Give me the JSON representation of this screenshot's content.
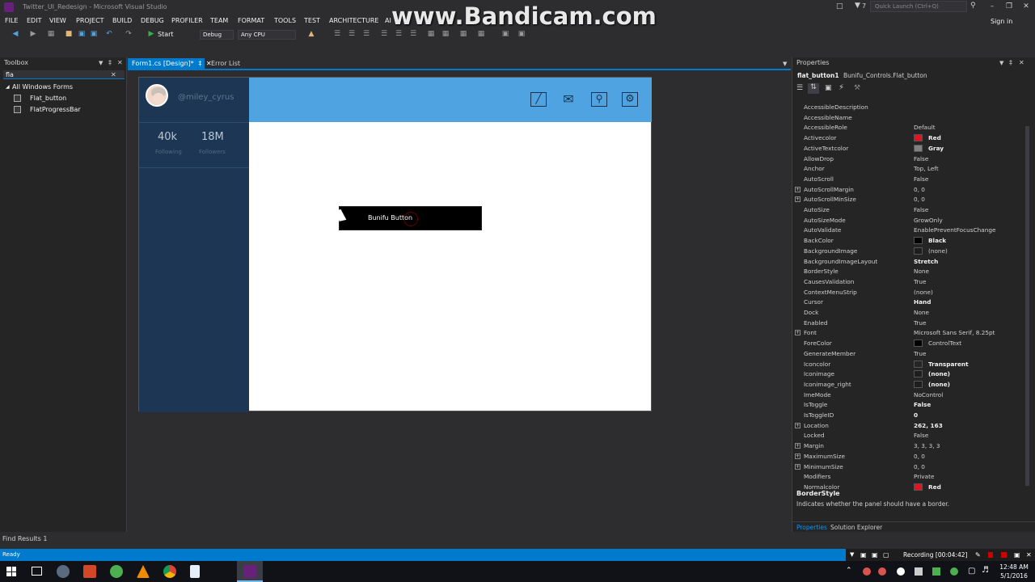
{
  "window": {
    "title": "Twitter_UI_Redesign - Microsoft Visual Studio",
    "notification_count": "7",
    "quick_launch_placeholder": "Quick Launch (Ctrl+Q)",
    "sign_in": "Sign in"
  },
  "watermark": "www.Bandicam.com",
  "menu": [
    "FILE",
    "EDIT",
    "VIEW",
    "PROJECT",
    "BUILD",
    "DEBUG",
    "PROFILER",
    "TEAM",
    "FORMAT",
    "TOOLS",
    "TEST",
    "ARCHITECTURE",
    "AI"
  ],
  "toolbar": {
    "start_label": "Start",
    "config": "Debug",
    "platform": "Any CPU"
  },
  "toolbox": {
    "title": "Toolbox",
    "search_value": "fla",
    "group": "All Windows Forms",
    "items": [
      "Flat_button",
      "FlatProgressBar"
    ]
  },
  "tabs": [
    "Form1.cs [Design]*",
    "Error List"
  ],
  "form": {
    "username": "@miley_cyrus",
    "following_count": "40k",
    "following_label": "Following",
    "followers_count": "18M",
    "followers_label": "Followers",
    "button_text": "Bunifu Button"
  },
  "properties": {
    "title": "Properties",
    "object_name": "flat_button1",
    "object_type": "Bunifu_Controls.Flat_button",
    "rows": [
      {
        "name": "AccessibleDescription",
        "value": ""
      },
      {
        "name": "AccessibleName",
        "value": ""
      },
      {
        "name": "AccessibleRole",
        "value": "Default"
      },
      {
        "name": "Activecolor",
        "value": "Red",
        "swatch": "#e81123",
        "bold": true
      },
      {
        "name": "ActiveTextcolor",
        "value": "Gray",
        "swatch": "#808080",
        "bold": true
      },
      {
        "name": "AllowDrop",
        "value": "False"
      },
      {
        "name": "Anchor",
        "value": "Top, Left"
      },
      {
        "name": "AutoScroll",
        "value": "False"
      },
      {
        "name": "AutoScrollMargin",
        "value": "0, 0",
        "expand": true
      },
      {
        "name": "AutoScrollMinSize",
        "value": "0, 0",
        "expand": true
      },
      {
        "name": "AutoSize",
        "value": "False"
      },
      {
        "name": "AutoSizeMode",
        "value": "GrowOnly"
      },
      {
        "name": "AutoValidate",
        "value": "EnablePreventFocusChange"
      },
      {
        "name": "BackColor",
        "value": "Black",
        "swatch": "#000000",
        "bold": true
      },
      {
        "name": "BackgroundImage",
        "value": "(none)",
        "swatch": "#1e1e1e"
      },
      {
        "name": "BackgroundImageLayout",
        "value": "Stretch",
        "bold": true
      },
      {
        "name": "BorderStyle",
        "value": "None"
      },
      {
        "name": "CausesValidation",
        "value": "True"
      },
      {
        "name": "ContextMenuStrip",
        "value": "(none)"
      },
      {
        "name": "Cursor",
        "value": "Hand",
        "bold": true
      },
      {
        "name": "Dock",
        "value": "None"
      },
      {
        "name": "Enabled",
        "value": "True"
      },
      {
        "name": "Font",
        "value": "Microsoft Sans Serif, 8.25pt",
        "expand": true
      },
      {
        "name": "ForeColor",
        "value": "ControlText",
        "swatch": "#000000"
      },
      {
        "name": "GenerateMember",
        "value": "True"
      },
      {
        "name": "Iconcolor",
        "value": "Transparent",
        "swatch": "#252526",
        "bold": true
      },
      {
        "name": "Iconimage",
        "value": "(none)",
        "swatch": "#1e1e1e",
        "bold": true
      },
      {
        "name": "Iconimage_right",
        "value": "(none)",
        "swatch": "#1e1e1e",
        "bold": true
      },
      {
        "name": "ImeMode",
        "value": "NoControl"
      },
      {
        "name": "IsToggle",
        "value": "False",
        "bold": true
      },
      {
        "name": "IsToggleID",
        "value": "0",
        "bold": true
      },
      {
        "name": "Location",
        "value": "262, 163",
        "expand": true,
        "bold": true
      },
      {
        "name": "Locked",
        "value": "False"
      },
      {
        "name": "Margin",
        "value": "3, 3, 3, 3",
        "expand": true
      },
      {
        "name": "MaximumSize",
        "value": "0, 0",
        "expand": true
      },
      {
        "name": "MinimumSize",
        "value": "0, 0",
        "expand": true
      },
      {
        "name": "Modifiers",
        "value": "Private"
      },
      {
        "name": "Normalcolor",
        "value": "Red",
        "swatch": "#e81123",
        "bold": true
      }
    ],
    "desc_title": "BorderStyle",
    "desc_text": "Indicates whether the panel should have a border.",
    "bottom_tabs": [
      "Properties",
      "Solution Explorer"
    ]
  },
  "find_results": "Find Results 1",
  "status": {
    "left": "Ready",
    "recording": "Recording [00:04:42]"
  },
  "taskbar": {
    "time": "12:48 AM",
    "date": "5/1/2016"
  },
  "colors": {
    "accent": "#007acc",
    "sidebar": "#1d3653",
    "header": "#4fa3e0"
  }
}
